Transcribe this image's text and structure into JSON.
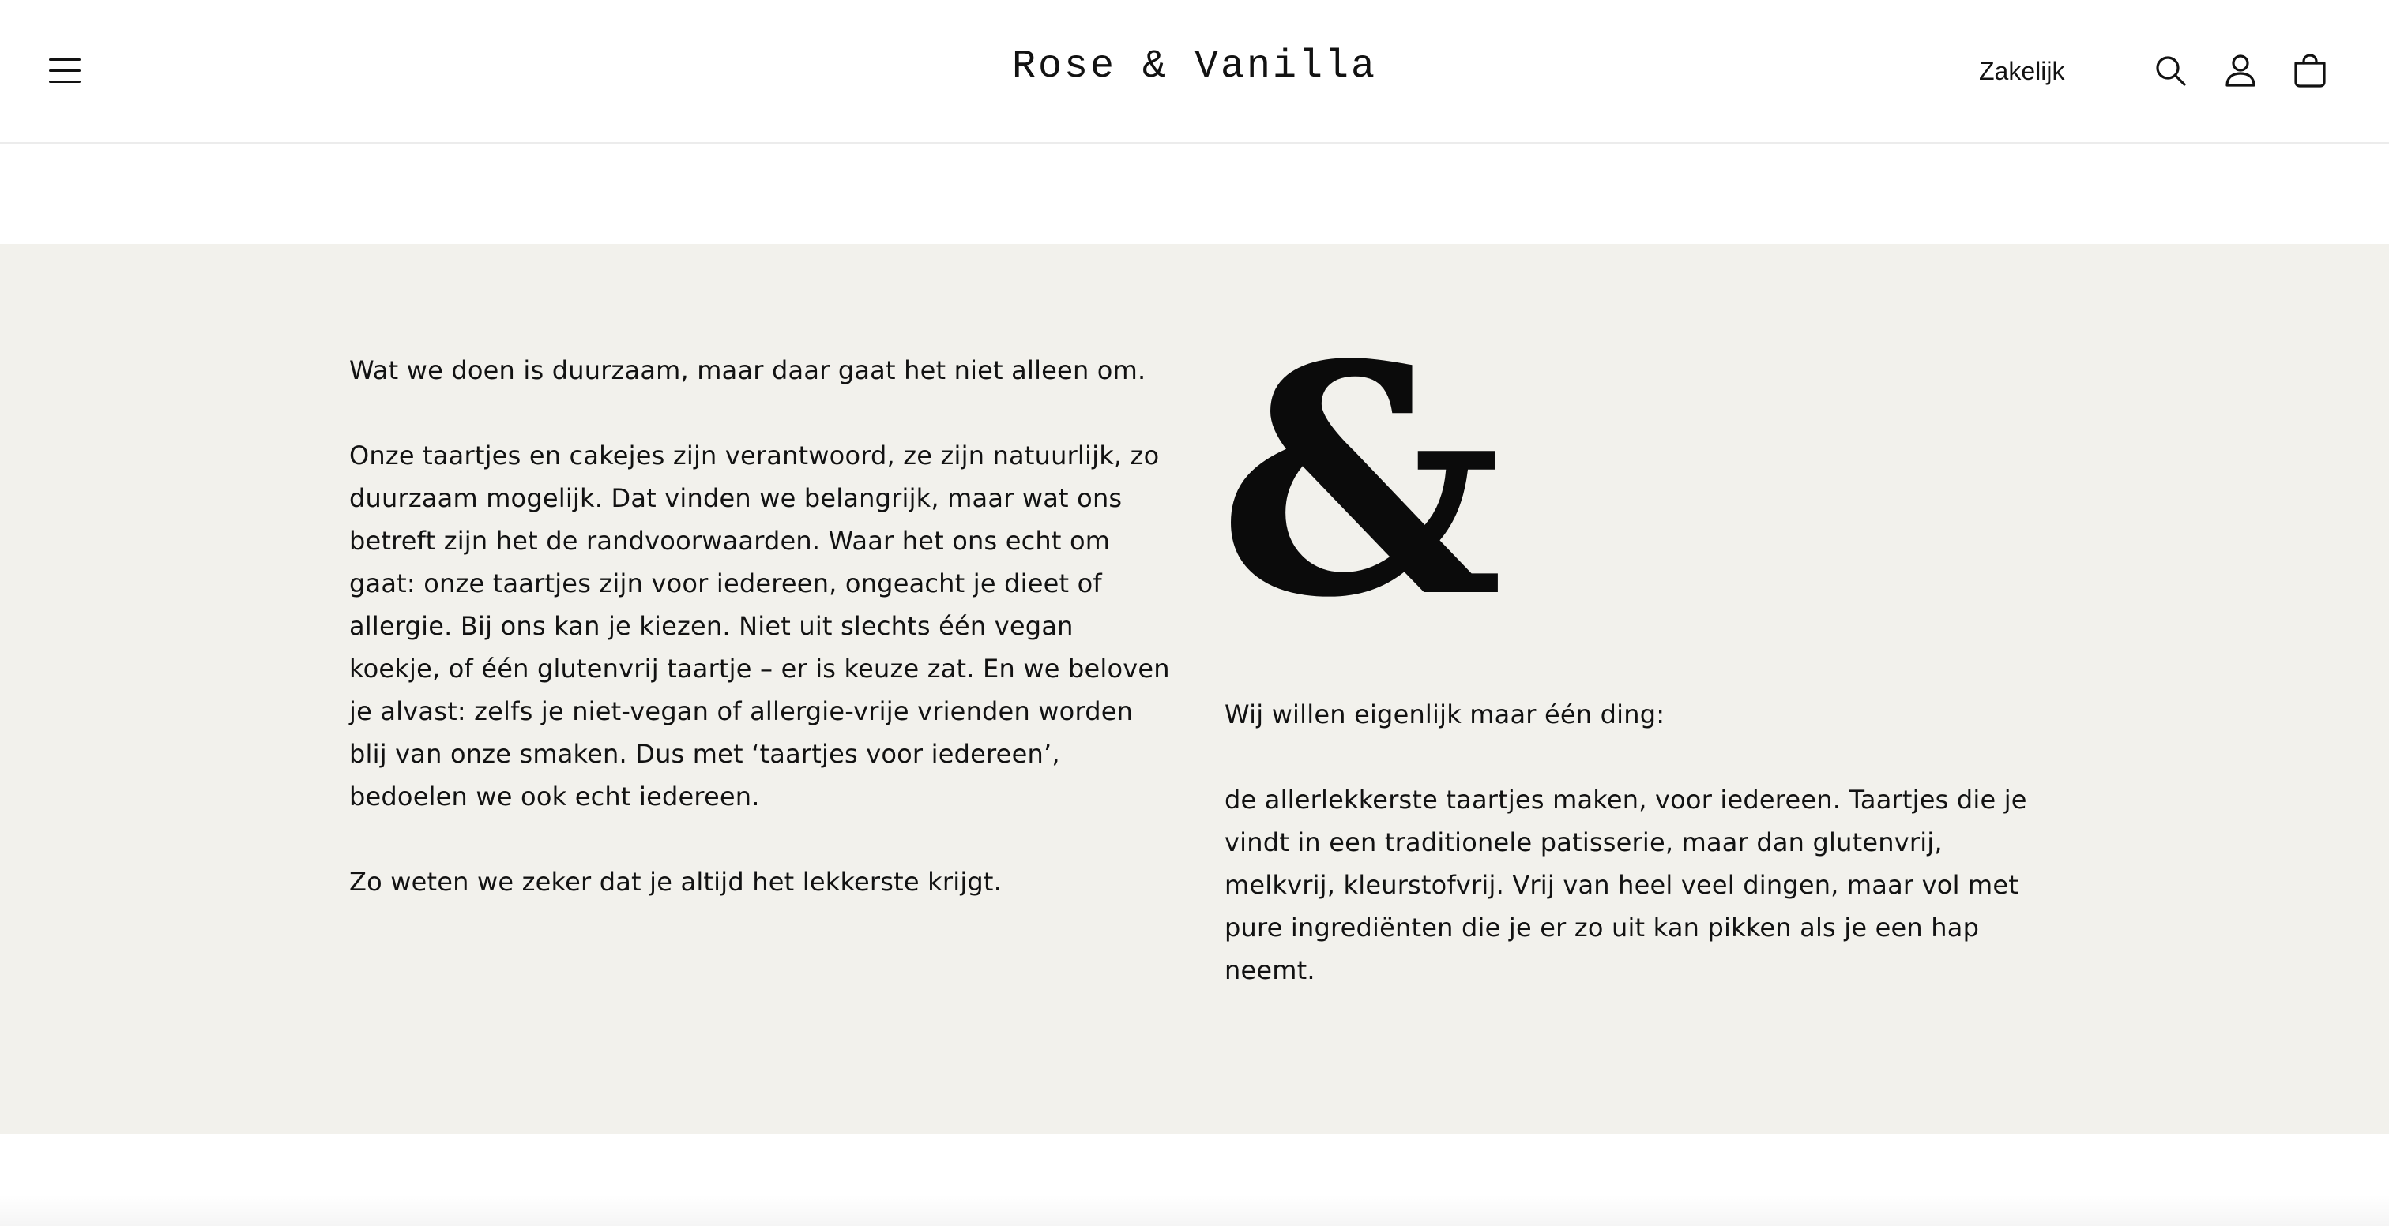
{
  "header": {
    "logo": "Rose & Vanilla",
    "nav_link": "Zakelijk",
    "icons": [
      "menu-icon",
      "search-icon",
      "account-icon",
      "cart-icon"
    ]
  },
  "content": {
    "left_paragraphs": [
      "Wat we doen is duurzaam, maar daar gaat het niet alleen om.",
      "Onze taartjes en cakejes zijn verantwoord, ze zijn natuurlijk, zo duurzaam mogelijk. Dat vinden we belangrijk, maar wat ons betreft zijn het de randvoorwaarden. Waar het ons echt om gaat: onze taartjes zijn voor iedereen, ongeacht je dieet of allergie. Bij ons kan je kiezen. Niet uit slechts één vegan koekje, of één glutenvrij taartje – er is keuze zat. En we beloven je alvast: zelfs je niet-vegan of allergie-vrije vrienden worden blij van onze smaken. Dus met ‘taartjes voor iedereen’, bedoelen we ook echt iedereen.",
      "Zo weten we zeker dat je altijd het lekkerste krijgt."
    ],
    "ampersand": "&",
    "right_paragraphs": [
      "Wij willen eigenlijk maar één ding:",
      "de allerlekkerste taartjes maken, voor iedereen. Taartjes die je vindt in een traditionele patisserie, maar dan glutenvrij, melkvrij, kleurstofvrij. Vrij van heel veel dingen, maar vol met pure ingrediënten die je er zo uit kan pikken als je een hap neemt."
    ]
  },
  "colors": {
    "band_background": "#f2f1ec",
    "text": "#121212",
    "page_background": "#ffffff"
  }
}
